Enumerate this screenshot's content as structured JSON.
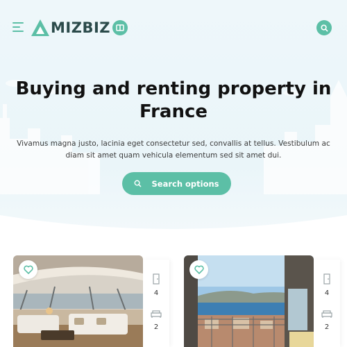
{
  "brand": {
    "name": "MIZBIZ",
    "accent": "#5cbfa6",
    "logo_text_color": "#2b4a4a"
  },
  "header": {
    "menu_icon": "hamburger-icon",
    "book_icon": "book-icon",
    "search_icon": "search-icon"
  },
  "hero": {
    "title": "Buying and renting property in France",
    "description": "Vivamus magna justo, lacinia eget consectetur sed, convallis at tellus. Vestibulum ac diam sit amet quam vehicula elementum sed sit amet dui.",
    "cta_label": "Search options"
  },
  "listings": [
    {
      "photo": "yacht-lounge-interior",
      "favorite_icon": "heart-icon",
      "doors": "4",
      "beds": "2"
    },
    {
      "photo": "balcony-sea-view",
      "favorite_icon": "heart-icon",
      "doors": "4",
      "beds": "2"
    }
  ]
}
